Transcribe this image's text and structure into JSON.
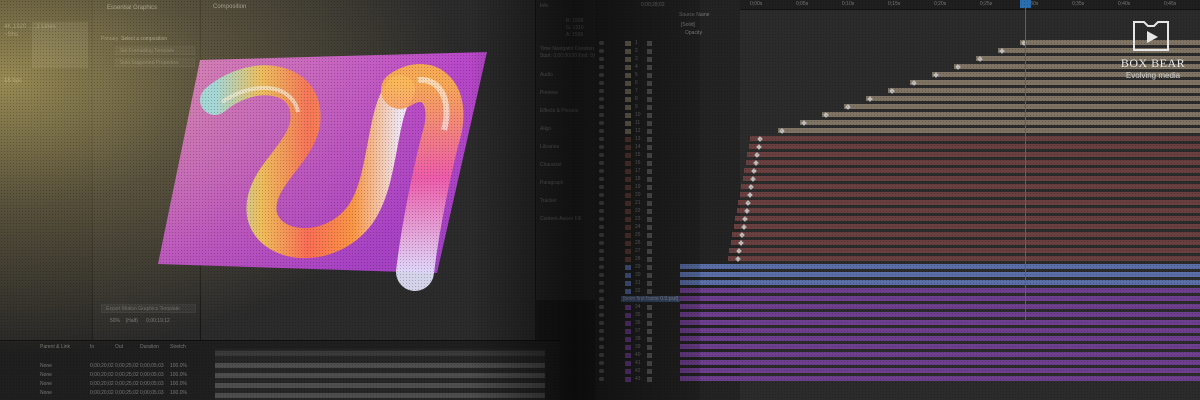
{
  "essential_graphics": {
    "title": "Essential Graphics",
    "primary_label": "Primary",
    "select_composition": "Select a composition",
    "btn_add_formatting": "Set Formatting Template",
    "btn_solo": "Solo Supported Properties",
    "btn_export": "Export Motion Graphics Template"
  },
  "left_panel": {
    "row1": "4K,1920 ... ,1 Lines",
    "row2": "~Shs",
    "row3": "16 bpc"
  },
  "composition": {
    "tab_label": "Composition",
    "footer_zoom": "50%",
    "footer_res": "(Half)",
    "footer_time": "0;00;19;12"
  },
  "side_panel": {
    "info_title": "Info",
    "info_lines": [
      "R: 1556",
      "G: 1316",
      "A: 1506"
    ],
    "nav_text": "Time Navigator Duration",
    "nav_value": "Start: 0;00;00;00  End: 0;00;51;13",
    "items": [
      "Audio",
      "Preview",
      "Effects & Presets",
      "Align",
      "Libraries",
      "Character",
      "Paragraph",
      "Tracker",
      "Content-Aware Fill"
    ]
  },
  "timeline": {
    "timecode": "0;00;28;02",
    "ruler_ticks": [
      "0;00s",
      "0;05s",
      "0;10s",
      "0;15s",
      "0;20s",
      "0;25s",
      "0;30s",
      "0;35s",
      "0;40s",
      "0;45s"
    ],
    "layer_header": "Source Name",
    "layer_labels": [
      "[Solid]",
      "Opacity"
    ],
    "layer_name_highlight": "[beim first frame 0.0.psd]",
    "layer_numbers": [
      "1",
      "2",
      "3",
      "4",
      "5",
      "6",
      "7",
      "8",
      "9",
      "10",
      "11",
      "12",
      "13",
      "14",
      "15",
      "16",
      "17",
      "18",
      "19",
      "20",
      "21",
      "22",
      "23",
      "24",
      "25",
      "26",
      "27",
      "28",
      "29",
      "30",
      "31",
      "32",
      "33",
      "34",
      "35",
      "36",
      "37",
      "38",
      "39",
      "40",
      "41",
      "42",
      "43"
    ]
  },
  "bottom_timeline": {
    "headers": [
      "Parent & Link",
      "In",
      "Out",
      "Duration",
      "Stretch"
    ],
    "rows": [
      [
        "None",
        "0;00;20;02",
        "0;00;25;02",
        "0;00;05;03",
        "100.0%"
      ],
      [
        "None",
        "0;00;20;02",
        "0;00;25;02",
        "0;00;05;03",
        "100.0%"
      ],
      [
        "None",
        "0;00;20;02",
        "0;00;25;02",
        "0;00;05;03",
        "100.0%"
      ],
      [
        "None",
        "0;00;20;02",
        "0;00;25;02",
        "0;00;05;03",
        "100.0%"
      ]
    ]
  },
  "logo": {
    "name": "BOX BEAR",
    "tagline": "Evolving media"
  },
  "colors": {
    "playhead": "#2a6fb0",
    "layer_tan": "#7f7464",
    "layer_red": "#6a3f3f",
    "layer_purple": "#6f3f8f",
    "layer_blue": "#5a6fa8"
  }
}
